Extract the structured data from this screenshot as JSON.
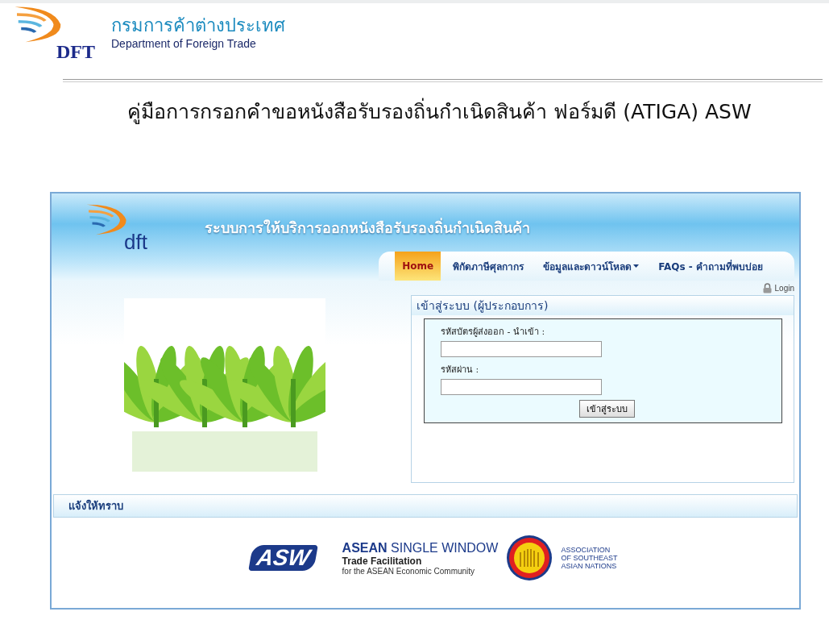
{
  "document_header": {
    "org_name_thai": "กรมการค้าต่างประเทศ",
    "org_name_english": "Department of Foreign Trade",
    "logo_text": "DFT"
  },
  "document_title": "คู่มือการกรอกคำขอหนังสือรับรองถิ่นกำเนิดสินค้า ฟอร์มดี (ATIGA) ASW",
  "site": {
    "logo_text": "dft",
    "title": "ระบบการให้บริการออกหนังสือรับรองถิ่นกำเนิดสินค้า",
    "nav": [
      {
        "label": "Home",
        "selected": true,
        "dropdown": false
      },
      {
        "label": "พิกัดภาษีศุลกากร",
        "selected": false,
        "dropdown": false
      },
      {
        "label": "ข้อมูลและดาวน์โหลด",
        "selected": false,
        "dropdown": true
      },
      {
        "label": "FAQs - คำถามที่พบบ่อย",
        "selected": false,
        "dropdown": false
      }
    ],
    "login_link": "Login",
    "login_panel": {
      "title": "เข้าสู่ระบบ (ผู้ประกอบการ)",
      "fields": [
        {
          "label": "รหัสบัตรผู้ส่งออก - นำเข้า :"
        },
        {
          "label": "รหัสผ่าน :"
        }
      ],
      "submit": "เข้าสู่ระบบ"
    },
    "notice_title": "แจ้งให้ทราบ",
    "asw_logo": {
      "mark": "ASW",
      "title_bold": "ASEAN",
      "title_rest": "SINGLE WINDOW",
      "subtitle": "Trade Facilitation",
      "tagline": "for the ASEAN Economic Community"
    },
    "asean_logo": {
      "lines": [
        "ASSOCIATION",
        "OF SOUTHEAST",
        "ASIAN NATIONS"
      ]
    }
  }
}
